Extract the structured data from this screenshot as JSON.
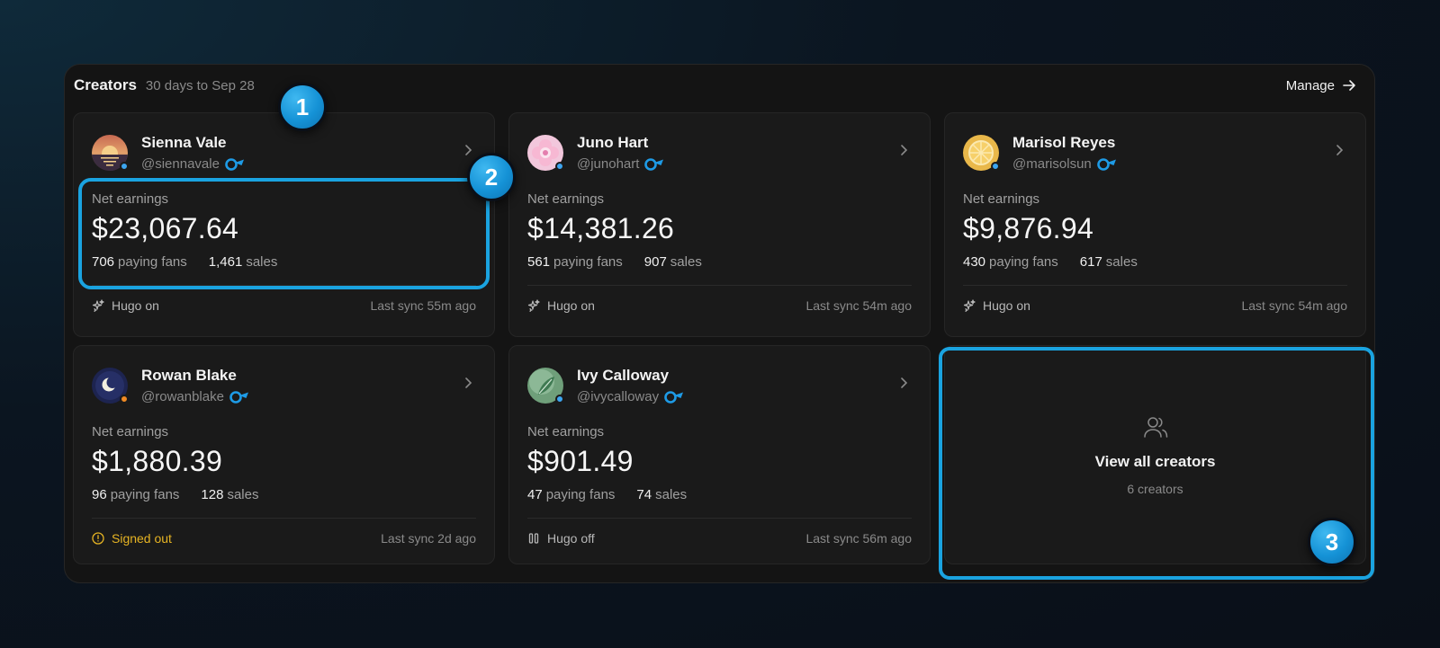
{
  "header": {
    "title": "Creators",
    "subtitle": "30 days to Sep 28",
    "manage_label": "Manage"
  },
  "labels": {
    "net_earnings": "Net earnings",
    "paying_fans": "paying fans",
    "sales": "sales"
  },
  "creators": [
    {
      "name": "Sienna Vale",
      "handle": "@siennavale",
      "net_earnings": "$23,067.64",
      "paying_fans": "706",
      "sales": "1,461",
      "hugo_status": "Hugo on",
      "last_sync": "Last sync 55m ago",
      "status_color": "#3da5f0",
      "avatar": "sunset-icon"
    },
    {
      "name": "Juno Hart",
      "handle": "@junohart",
      "net_earnings": "$14,381.26",
      "paying_fans": "561",
      "sales": "907",
      "hugo_status": "Hugo on",
      "last_sync": "Last sync 54m ago",
      "status_color": "#3da5f0",
      "avatar": "flower-icon"
    },
    {
      "name": "Marisol Reyes",
      "handle": "@marisolsun",
      "net_earnings": "$9,876.94",
      "paying_fans": "430",
      "sales": "617",
      "hugo_status": "Hugo on",
      "last_sync": "Last sync 54m ago",
      "status_color": "#3da5f0",
      "avatar": "citrus-icon"
    },
    {
      "name": "Rowan Blake",
      "handle": "@rowanblake",
      "net_earnings": "$1,880.39",
      "paying_fans": "96",
      "sales": "128",
      "hugo_status": "Signed out",
      "last_sync": "Last sync 2d ago",
      "status_color": "#f08a24",
      "avatar": "moon-icon"
    },
    {
      "name": "Ivy Calloway",
      "handle": "@ivycalloway",
      "net_earnings": "$901.49",
      "paying_fans": "47",
      "sales": "74",
      "hugo_status": "Hugo off",
      "last_sync": "Last sync 56m ago",
      "status_color": "#3da5f0",
      "avatar": "leaf-icon"
    }
  ],
  "view_all": {
    "label": "View all creators",
    "count": "6 creators",
    "icon": "users-icon"
  },
  "annotations": {
    "badge_1": "1",
    "badge_2": "2",
    "badge_3": "3",
    "highlight_color": "#1aa3e0"
  },
  "colors": {
    "accent": "#1aa3e0",
    "warning": "#e6b423",
    "verified": "#1e9be6"
  }
}
